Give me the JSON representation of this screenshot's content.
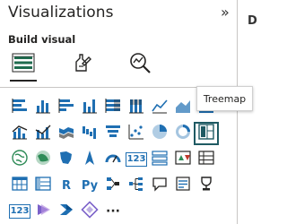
{
  "pane": {
    "title": "Visualizations",
    "collapse_glyph": "»",
    "right_pane_initial": "D"
  },
  "build_visual": {
    "label": "Build visual",
    "tabs": [
      {
        "id": "build",
        "icon": "build-visual-icon",
        "selected": true
      },
      {
        "id": "format",
        "icon": "format-visual-icon",
        "selected": false
      },
      {
        "id": "analytics",
        "icon": "analytics-icon",
        "selected": false
      }
    ]
  },
  "tooltip": {
    "text": "Treemap"
  },
  "gallery": {
    "rows": [
      [
        "stacked-bar-chart-icon",
        "stacked-column-chart-icon",
        "clustered-bar-chart-icon",
        "clustered-column-chart-icon",
        "100-stacked-bar-chart-icon",
        "100-stacked-column-chart-icon",
        "line-chart-icon",
        "area-chart-icon",
        "stacked-area-chart-icon"
      ],
      [
        "line-stacked-column-chart-icon",
        "line-clustered-column-chart-icon",
        "ribbon-chart-icon",
        "waterfall-chart-icon",
        "funnel-chart-icon",
        "scatter-chart-icon",
        "pie-chart-icon",
        "donut-chart-icon",
        "treemap-icon"
      ],
      [
        "map-icon",
        "filled-map-icon",
        "shape-map-icon",
        "azure-map-icon",
        "gauge-icon",
        "card-icon",
        "multi-row-card-icon",
        "kpi-icon",
        "slicer-icon"
      ],
      [
        "table-icon",
        "matrix-icon",
        "r-script-visual-icon",
        "python-visual-icon",
        "key-influencers-icon",
        "decomposition-tree-icon",
        "qa-icon",
        "smart-narrative-icon",
        "metrics-icon"
      ],
      [
        "paginated-report-icon",
        "power-apps-icon",
        "power-automate-icon",
        "get-more-visuals-icon",
        "more-options-icon"
      ]
    ],
    "text_icons": {
      "r-script-visual-icon": "R",
      "python-visual-icon": "Py",
      "card-icon": "123",
      "paginated-report-icon": "123",
      "more-options-icon": "···"
    },
    "selected": "treemap-icon"
  },
  "colors": {
    "accent": "#1f6fb2",
    "dark": "#252423",
    "teal": "#1f5a63",
    "orange": "#e8752a",
    "green": "#2e8b57",
    "purple": "#7b61c9"
  }
}
